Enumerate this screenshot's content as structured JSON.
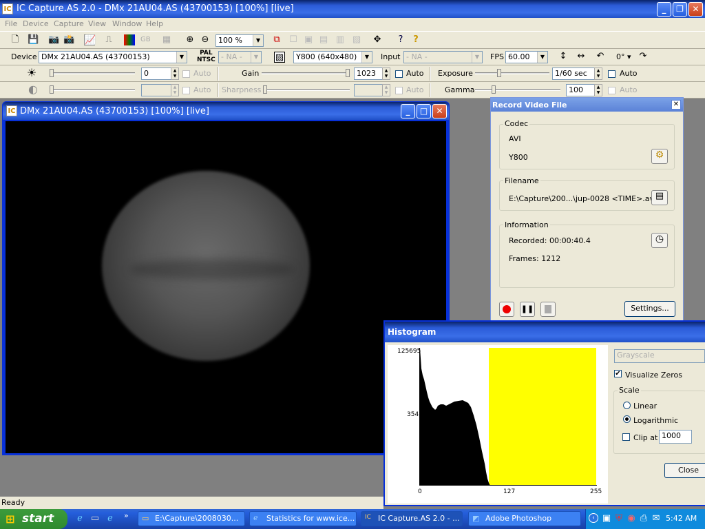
{
  "app": {
    "title": "IC Capture.AS 2.0 - DMx 21AU04.AS (43700153) [100%]  [live]"
  },
  "menu": [
    "File",
    "Device",
    "Capture",
    "View",
    "Window",
    "Help"
  ],
  "toolbar": {
    "zoom": "100 %",
    "color_format_label": "GB"
  },
  "device_bar": {
    "device_label": "Device",
    "device_value": "DMx 21AU04.AS (43700153)",
    "pal_ntsc_top": "PAL",
    "pal_ntsc_bottom": "NTSC",
    "video_norm": "- NA -",
    "format": "Y800 (640x480)",
    "input_label": "Input",
    "input_value": "- NA -",
    "fps_label": "FPS",
    "fps_value": "60.00",
    "rotation": "0°"
  },
  "props_row1": {
    "brightness_value": "0",
    "auto": "Auto",
    "gain_label": "Gain",
    "gain_value": "1023",
    "exposure_label": "Exposure",
    "exposure_value": "1/60 sec"
  },
  "props_row2": {
    "auto": "Auto",
    "sharpness_label": "Sharpness",
    "gamma_label": "Gamma",
    "gamma_value": "100"
  },
  "live_window": {
    "title": "DMx 21AU04.AS (43700153) [100%]  [live]"
  },
  "record": {
    "title": "Record Video File",
    "codec_label": "Codec",
    "codec_container": "AVI",
    "codec_format": "Y800",
    "filename_label": "Filename",
    "filename_value": "E:\\Capture\\200...\\jup-0028 <TIME>.avi",
    "info_label": "Information",
    "recorded": "Recorded: 00:00:40.4",
    "frames": "Frames: 1212",
    "settings_button": "Settings..."
  },
  "histogram": {
    "title": "Histogram",
    "y_max": "125695",
    "y_mid": "354",
    "x_min": "0",
    "x_mid": "127",
    "x_max": "255",
    "channel": "Grayscale",
    "visualize_zeros": "Visualize Zeros",
    "scale_label": "Scale",
    "linear": "Linear",
    "logarithmic": "Logarithmic",
    "clip_at": "Clip at",
    "clip_value": "1000",
    "close": "Close",
    "colors": {
      "highlight": "#ffff00",
      "bars": "#000000"
    }
  },
  "status": {
    "text": "Ready"
  },
  "taskbar": {
    "start": "start",
    "buttons": [
      "E:\\Capture\\2008030...",
      "Statistics for www.ice...",
      "IC Capture.AS 2.0 - ...",
      "Adobe Photoshop"
    ],
    "clock": "5:42 AM"
  }
}
